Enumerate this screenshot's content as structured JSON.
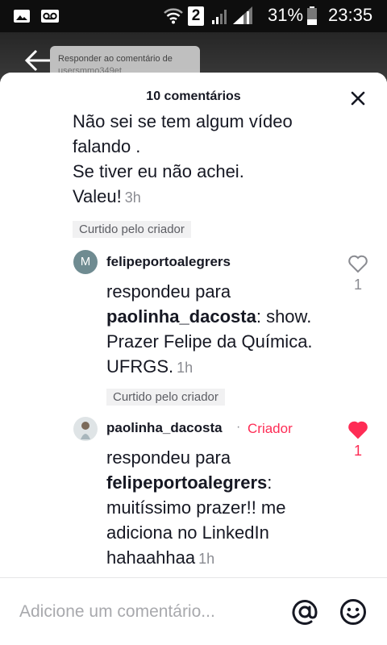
{
  "status_bar": {
    "sim_label": "2",
    "battery": "31%",
    "time": "23:35",
    "icons": [
      "gallery-icon",
      "voicemail-icon",
      "wifi-icon",
      "signal-icon",
      "battery-icon"
    ]
  },
  "background": {
    "reply_hint_line1": "Responder ao comentário de",
    "reply_hint_line2": "usersmmo349et"
  },
  "sheet": {
    "title": "10 comentários",
    "close_icon": "close-icon"
  },
  "comments": {
    "parent": {
      "text_lines": [
        "Não sei se tem algum vídeo",
        "falando .",
        "Se tiver eu não achei.",
        "Valeu!"
      ],
      "timestamp": "3h",
      "liked_badge": "Curtido pelo criador"
    },
    "reply1": {
      "username": "felipeportoalegrers",
      "avatar_letter": "M",
      "replied_to_prefix": "respondeu para",
      "replied_to_user": "paolinha_dacosta",
      "text": ": show.",
      "text_lines": [
        "Prazer Felipe da Química.",
        "UFRGS."
      ],
      "timestamp": "1h",
      "liked_badge": "Curtido pelo criador",
      "likes": "1",
      "liked": false
    },
    "reply2": {
      "username": "paolinha_dacosta",
      "separator": "·",
      "creator_label": "Criador",
      "replied_to_prefix": "respondeu para",
      "replied_to_user": "felipeportoalegrers",
      "text": ":",
      "text_lines": [
        "muitíssimo prazer!! me",
        "adiciona no LinkedIn",
        "hahaahhaa"
      ],
      "timestamp": "1h",
      "likes": "1",
      "liked": true
    }
  },
  "composer": {
    "placeholder": "Adicione um comentário...",
    "mention_icon": "at-icon",
    "emoji_icon": "emoji-icon"
  },
  "colors": {
    "accent": "#fe2c55",
    "text": "#161823",
    "muted": "#8a8b91"
  }
}
